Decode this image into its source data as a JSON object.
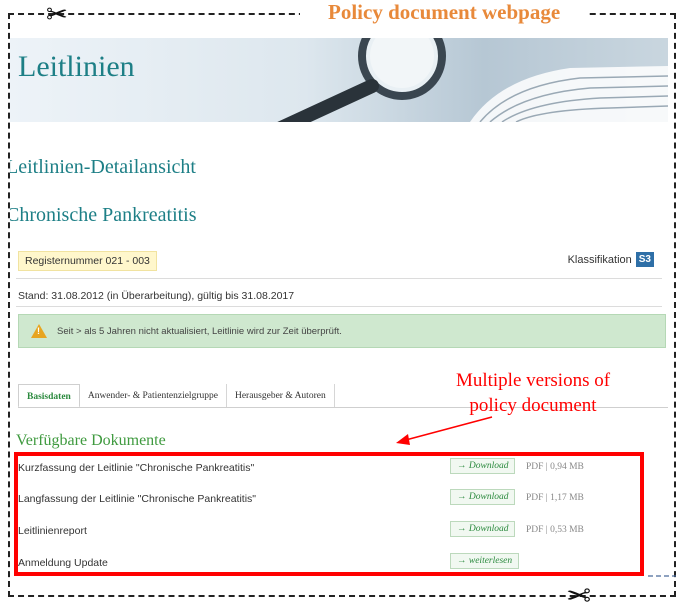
{
  "frame_label": "Policy document webpage",
  "banner": {
    "title": "Leitlinien"
  },
  "page": {
    "detail_title": "Leitlinien-Detailansicht",
    "doc_title": "Chronische Pankreatitis",
    "registry": "Registernummer 021 - 003",
    "klassifikation_label": "Klassifikation",
    "klassifikation_badge": "S3",
    "stand": "Stand: 31.08.2012 (in Überarbeitung), gültig bis 31.08.2017",
    "alert": "Seit > als 5 Jahren nicht aktualisiert, Leitlinie wird zur Zeit überprüft."
  },
  "tabs": [
    {
      "label": "Basisdaten"
    },
    {
      "label": "Anwender- & Patientenzielgruppe"
    },
    {
      "label": "Herausgeber & Autoren"
    }
  ],
  "documents": {
    "section_title": "Verfügbare Dokumente",
    "rows": [
      {
        "name": "Kurzfassung der Leitlinie \"Chronische Pankreatitis\"",
        "action": "→ Download",
        "meta": "PDF | 0,94 MB"
      },
      {
        "name": "Langfassung der Leitlinie \"Chronische Pankreatitis\"",
        "action": "→ Download",
        "meta": "PDF | 1,17 MB"
      },
      {
        "name": "Leitlinienreport",
        "action": "→ Download",
        "meta": "PDF | 0,53 MB"
      },
      {
        "name": "Anmeldung Update",
        "action": "→ weiterlesen",
        "meta": ""
      }
    ]
  },
  "annotation": {
    "line1": "Multiple versions of",
    "line2": "policy document"
  },
  "icons": {
    "scissors": "scissors-icon",
    "warning": "warning-icon",
    "magnifier": "magnifier-icon"
  },
  "colors": {
    "teal_title": "#1d7f86",
    "green": "#3f9a3f",
    "highlight": "#ff0000",
    "label_orange": "#e8893a"
  }
}
